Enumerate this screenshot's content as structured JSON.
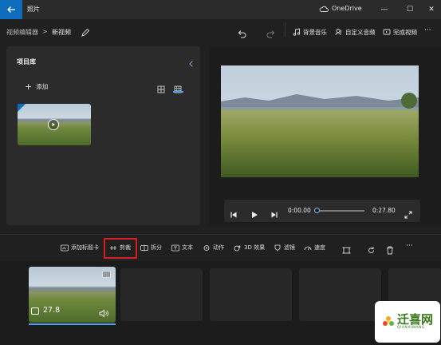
{
  "titlebar": {
    "app_title": "照片",
    "onedrive_label": "OneDrive",
    "minimize": "—",
    "maximize": "☐",
    "close": "✕"
  },
  "toolbar": {
    "breadcrumb_parent": "视频编辑器",
    "breadcrumb_sep": ">",
    "breadcrumb_current": "新视频",
    "background_music": "背景音乐",
    "custom_audio": "自定义音频",
    "finish_video": "完成视频",
    "more": "···"
  },
  "library": {
    "title": "项目库",
    "add_label": "添加",
    "add_symbol": "+"
  },
  "player": {
    "current_time": "0:00.00",
    "total_time": "0:27.80",
    "progress": 0
  },
  "edit_bar": {
    "add_title_card": "添加标题卡",
    "trim": "剪裁",
    "split": "拆分",
    "text": "文本",
    "motion": "动作",
    "effects_3d": "3D 效果",
    "filters": "滤镜",
    "speed": "速度",
    "more": "···"
  },
  "storyboard": {
    "clip_duration": "27.8"
  },
  "watermark": {
    "text": "迁喜网",
    "sub": "QIANXIWANG"
  },
  "colors": {
    "accent": "#0f6cbd",
    "highlight": "#d41f1f",
    "timeline_accent": "#4aa3f0"
  }
}
